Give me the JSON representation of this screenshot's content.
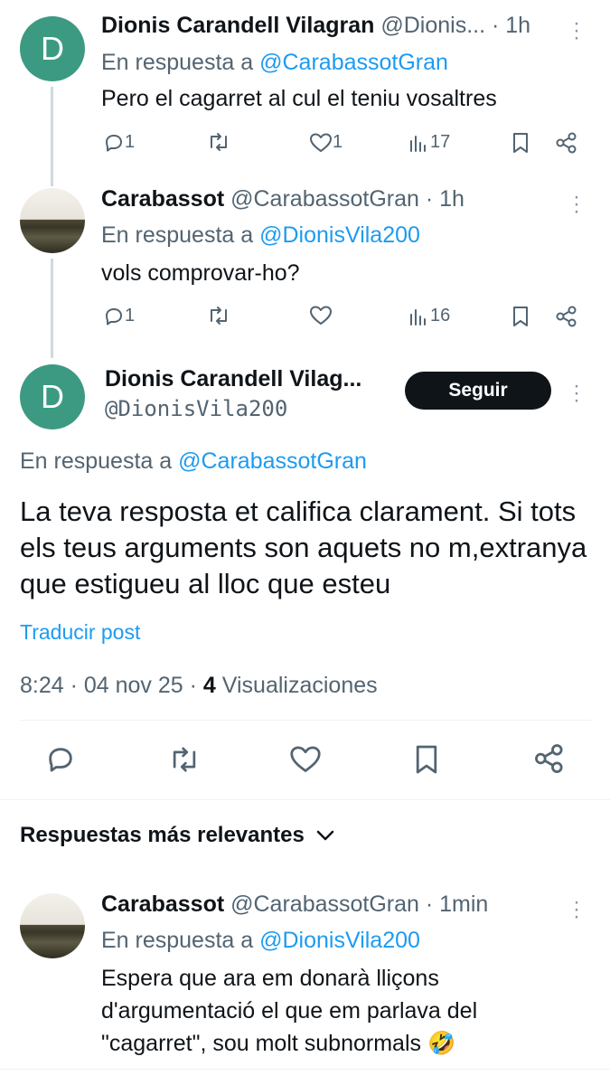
{
  "replies_top": [
    {
      "avatar_letter": "D",
      "name": "Dionis Carandell Vilagran",
      "handle_time": "@Dionis... · 1h",
      "reply_prefix": "En respuesta a",
      "reply_to": "@CarabassotGran",
      "text": "Pero el cagarret al cul el teniu vosaltres",
      "replies": "1",
      "likes": "1",
      "views": "17"
    },
    {
      "name": "Carabassot",
      "handle_time": "@CarabassotGran · 1h",
      "reply_prefix": "En respuesta a",
      "reply_to": "@DionisVila200",
      "text": "vols comprovar-ho?",
      "replies": "1",
      "likes": "",
      "views": "16"
    }
  ],
  "main_post": {
    "avatar_letter": "D",
    "name": "Dionis Carandell Vilag...",
    "handle": "@DionisVila200",
    "follow_label": "Seguir",
    "reply_prefix": "En respuesta a",
    "reply_to": "@CarabassotGran",
    "text": "La teva resposta et califica clarament. Si tots els teus arguments son aquets no m,extranya que estigueu al lloc que esteu",
    "translate_label": "Traducir post",
    "timestamp": "8:24 · 04 nov 25 · ",
    "views_count": "4",
    "views_label": " Visualizaciones"
  },
  "replies_header": {
    "label": "Respuestas más relevantes"
  },
  "bottom_reply": {
    "name": "Carabassot",
    "handle_time": "@CarabassotGran · 1min",
    "reply_prefix": "En respuesta a",
    "reply_to": "@DionisVila200",
    "text": "Espera que ara em donarà lliçons d'argumentació el que em parlava del \"cagarret\", sou molt subnormals 🤣"
  },
  "colors": {
    "accent_blue": "#1d9bf0",
    "avatar_green": "#3d9a82",
    "text_gray": "#536471"
  }
}
